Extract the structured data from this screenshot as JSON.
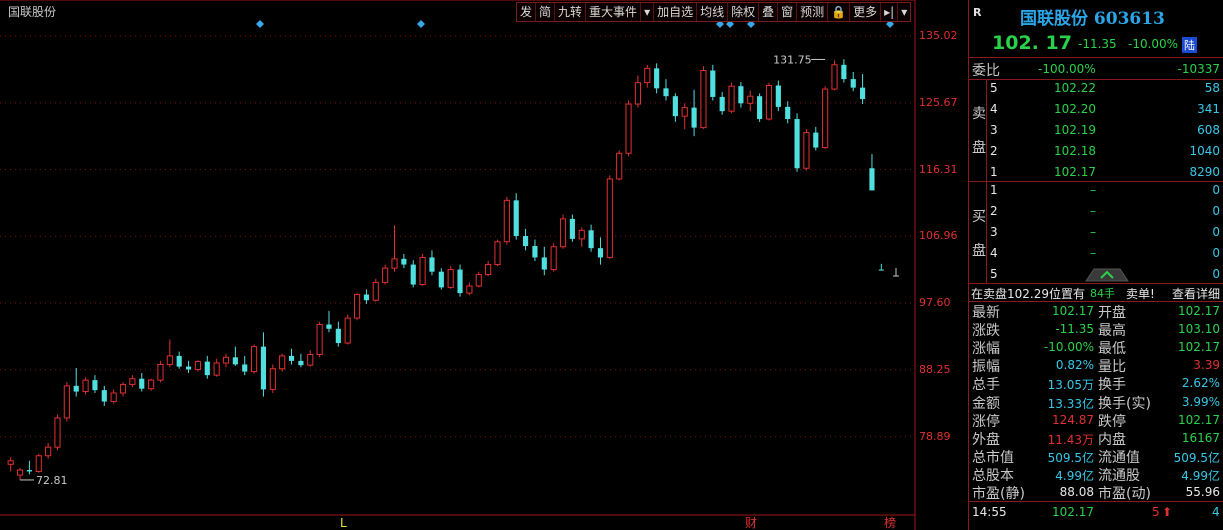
{
  "stock_label": "国联股份",
  "toolbar": [
    "发",
    "简",
    "九转",
    "重大事件",
    "▾",
    "加自选",
    "均线",
    "除权",
    "叠",
    "窗",
    "预测",
    "🔒",
    "更多",
    "▸|",
    "▾"
  ],
  "y_axis_labels": [
    "135.02",
    "125.67",
    "116.31",
    "106.96",
    "97.60",
    "88.25",
    "78.89"
  ],
  "chart_annotations": {
    "high": "131.75",
    "low": "72.81",
    "bottom_markers": [
      "L",
      "财",
      "榜"
    ]
  },
  "panel": {
    "r_logo": "R",
    "title": "国联股份 603613",
    "price": "102. 17",
    "change": "-11.35",
    "change_pct": "-10.00%",
    "limit_badge": "陆",
    "weibi_label": "委比",
    "weibi_pct": "-100.00%",
    "weibi_diff": "-10337",
    "sell_label": [
      "卖",
      "盘"
    ],
    "buy_label": [
      "买",
      "盘"
    ],
    "sell": [
      {
        "level": "5",
        "price": "102.22",
        "vol": "58"
      },
      {
        "level": "4",
        "price": "102.20",
        "vol": "341"
      },
      {
        "level": "3",
        "price": "102.19",
        "vol": "608"
      },
      {
        "level": "2",
        "price": "102.18",
        "vol": "1040"
      },
      {
        "level": "1",
        "price": "102.17",
        "vol": "8290"
      }
    ],
    "buy": [
      {
        "level": "1",
        "price": "–",
        "vol": "0"
      },
      {
        "level": "2",
        "price": "–",
        "vol": "0"
      },
      {
        "level": "3",
        "price": "–",
        "vol": "0"
      },
      {
        "level": "4",
        "price": "–",
        "vol": "0"
      },
      {
        "level": "5",
        "price": "–",
        "vol": "0"
      }
    ],
    "notice_prefix": "在卖盘102.29位置有",
    "notice_qty": "84手",
    "notice_suffix": "卖单!",
    "notice_link": "查看详细",
    "stats": [
      {
        "l1": "最新",
        "v1": "102.17",
        "c1": "g",
        "l2": "开盘",
        "v2": "102.17",
        "c2": "g"
      },
      {
        "l1": "涨跌",
        "v1": "-11.35",
        "c1": "g",
        "l2": "最高",
        "v2": "103.10",
        "c2": "g"
      },
      {
        "l1": "涨幅",
        "v1": "-10.00%",
        "c1": "g",
        "l2": "最低",
        "v2": "102.17",
        "c2": "g"
      },
      {
        "l1": "振幅",
        "v1": "0.82%",
        "c1": "c",
        "l2": "量比",
        "v2": "3.39",
        "c2": "r"
      },
      {
        "l1": "总手",
        "v1": "13.05万",
        "c1": "c",
        "l2": "换手",
        "v2": "2.62%",
        "c2": "c"
      },
      {
        "l1": "金额",
        "v1": "13.33亿",
        "c1": "c",
        "l2": "换手(实)",
        "v2": "3.99%",
        "c2": "c"
      },
      {
        "l1": "涨停",
        "v1": "124.87",
        "c1": "r",
        "l2": "跌停",
        "v2": "102.17",
        "c2": "g"
      },
      {
        "l1": "外盘",
        "v1": "11.43万",
        "c1": "r",
        "l2": "内盘",
        "v2": "16167",
        "c2": "g"
      },
      {
        "l1": "总市值",
        "v1": "509.5亿",
        "c1": "c",
        "l2": "流通值",
        "v2": "509.5亿",
        "c2": "c"
      },
      {
        "l1": "总股本",
        "v1": "4.99亿",
        "c1": "c",
        "l2": "流通股",
        "v2": "4.99亿",
        "c2": "c"
      },
      {
        "l1": "市盈(静)",
        "v1": "88.08",
        "c1": "w",
        "l2": "市盈(动)",
        "v2": "55.96",
        "c2": "w"
      }
    ],
    "tick": {
      "time": "14:55",
      "price": "102.17",
      "vol": "5",
      "n": "4"
    }
  },
  "chart_data": {
    "type": "candlestick",
    "ylim": [
      70,
      137
    ],
    "y_ticks": [
      135.02,
      125.67,
      116.31,
      106.96,
      97.6,
      88.25,
      78.89
    ],
    "high_mark": 131.75,
    "low_mark": 72.81,
    "candles": [
      [
        75.0,
        76.0,
        74.0,
        75.5
      ],
      [
        73.5,
        74.5,
        72.8,
        74.2
      ],
      [
        74.2,
        75.5,
        73.6,
        74.0
      ],
      [
        74.0,
        76.5,
        73.8,
        76.2
      ],
      [
        76.2,
        78.0,
        75.8,
        77.4
      ],
      [
        77.4,
        82.0,
        77.0,
        81.5
      ],
      [
        81.5,
        86.5,
        81.0,
        86.0
      ],
      [
        86.0,
        88.5,
        84.5,
        85.2
      ],
      [
        85.2,
        87.2,
        84.8,
        86.8
      ],
      [
        86.8,
        87.5,
        85.0,
        85.4
      ],
      [
        85.4,
        86.0,
        83.2,
        83.8
      ],
      [
        83.8,
        85.5,
        83.5,
        85.0
      ],
      [
        85.0,
        86.5,
        84.5,
        86.2
      ],
      [
        86.2,
        87.5,
        85.8,
        87.0
      ],
      [
        87.0,
        87.8,
        85.2,
        85.6
      ],
      [
        85.6,
        87.0,
        85.3,
        86.8
      ],
      [
        86.8,
        89.5,
        86.5,
        89.0
      ],
      [
        89.0,
        92.5,
        88.6,
        90.2
      ],
      [
        90.2,
        90.8,
        88.4,
        88.7
      ],
      [
        88.7,
        89.5,
        87.8,
        88.3
      ],
      [
        88.3,
        89.6,
        88.0,
        89.4
      ],
      [
        89.4,
        90.2,
        87.0,
        87.5
      ],
      [
        87.5,
        89.8,
        87.3,
        89.2
      ],
      [
        89.2,
        90.5,
        88.6,
        90.0
      ],
      [
        90.0,
        91.5,
        88.8,
        89.0
      ],
      [
        89.0,
        90.2,
        87.5,
        88.0
      ],
      [
        88.0,
        91.8,
        87.7,
        91.5
      ],
      [
        91.5,
        93.5,
        84.5,
        85.5
      ],
      [
        85.5,
        89.0,
        85.0,
        88.4
      ],
      [
        88.4,
        90.5,
        88.0,
        90.2
      ],
      [
        90.2,
        91.2,
        89.0,
        89.5
      ],
      [
        89.5,
        90.5,
        88.6,
        88.9
      ],
      [
        88.9,
        91.0,
        88.7,
        90.4
      ],
      [
        90.4,
        95.0,
        90.0,
        94.6
      ],
      [
        94.6,
        96.5,
        93.5,
        94.0
      ],
      [
        94.0,
        95.0,
        91.5,
        92.0
      ],
      [
        92.0,
        96.0,
        91.8,
        95.5
      ],
      [
        95.5,
        99.0,
        95.2,
        98.8
      ],
      [
        98.8,
        99.5,
        97.5,
        98.0
      ],
      [
        98.0,
        101.0,
        97.8,
        100.5
      ],
      [
        100.5,
        103.0,
        100.2,
        102.5
      ],
      [
        102.5,
        108.5,
        102.0,
        103.8
      ],
      [
        103.8,
        104.5,
        102.5,
        103.0
      ],
      [
        103.0,
        103.6,
        99.8,
        100.2
      ],
      [
        100.2,
        104.5,
        100.0,
        104.0
      ],
      [
        104.0,
        105.0,
        101.5,
        102.0
      ],
      [
        102.0,
        102.5,
        99.5,
        99.8
      ],
      [
        99.8,
        102.8,
        99.6,
        102.3
      ],
      [
        102.3,
        103.0,
        98.5,
        99.0
      ],
      [
        99.0,
        100.5,
        98.7,
        100.0
      ],
      [
        100.0,
        102.0,
        99.8,
        101.6
      ],
      [
        101.6,
        103.5,
        101.4,
        103.0
      ],
      [
        103.0,
        106.5,
        102.8,
        106.2
      ],
      [
        106.2,
        112.5,
        105.8,
        112.0
      ],
      [
        112.0,
        113.0,
        106.5,
        107.0
      ],
      [
        107.0,
        108.0,
        105.0,
        105.6
      ],
      [
        105.6,
        106.5,
        103.5,
        104.0
      ],
      [
        104.0,
        105.5,
        101.5,
        102.3
      ],
      [
        102.3,
        106.0,
        102.0,
        105.5
      ],
      [
        105.5,
        110.0,
        105.2,
        109.4
      ],
      [
        109.4,
        110.0,
        106.2,
        106.6
      ],
      [
        106.6,
        108.2,
        105.5,
        107.8
      ],
      [
        107.8,
        108.6,
        104.8,
        105.3
      ],
      [
        105.3,
        106.8,
        103.0,
        104.0
      ],
      [
        104.0,
        115.5,
        103.8,
        115.0
      ],
      [
        115.0,
        119.0,
        114.8,
        118.6
      ],
      [
        118.6,
        126.0,
        118.2,
        125.5
      ],
      [
        125.5,
        129.5,
        125.0,
        128.5
      ],
      [
        128.5,
        131.0,
        127.8,
        130.5
      ],
      [
        130.5,
        131.2,
        127.0,
        127.7
      ],
      [
        127.7,
        129.0,
        126.0,
        126.6
      ],
      [
        126.6,
        127.0,
        123.0,
        123.8
      ],
      [
        123.8,
        125.6,
        122.0,
        125.0
      ],
      [
        125.0,
        127.5,
        121.0,
        122.2
      ],
      [
        122.2,
        130.8,
        122.0,
        130.2
      ],
      [
        130.2,
        131.0,
        126.0,
        126.5
      ],
      [
        126.5,
        127.2,
        124.0,
        124.5
      ],
      [
        124.5,
        128.5,
        124.2,
        128.0
      ],
      [
        128.0,
        128.6,
        125.0,
        125.6
      ],
      [
        125.6,
        127.4,
        124.5,
        126.6
      ],
      [
        126.6,
        127.0,
        123.0,
        123.4
      ],
      [
        123.4,
        128.5,
        123.2,
        128.1
      ],
      [
        128.1,
        128.8,
        124.5,
        125.1
      ],
      [
        125.1,
        125.9,
        122.8,
        123.4
      ],
      [
        123.4,
        124.2,
        116.0,
        116.5
      ],
      [
        116.5,
        122.0,
        116.2,
        121.5
      ],
      [
        121.5,
        122.3,
        119.0,
        119.4
      ],
      [
        119.4,
        128.0,
        119.2,
        127.6
      ],
      [
        127.6,
        131.6,
        127.4,
        131.0
      ],
      [
        131.0,
        131.8,
        128.5,
        129.0
      ],
      [
        129.0,
        130.0,
        127.3,
        127.8
      ],
      [
        127.8,
        129.7,
        125.5,
        126.2
      ],
      [
        116.5,
        118.5,
        113.4,
        113.4
      ],
      [
        102.3,
        103.1,
        102.2,
        102.2
      ]
    ]
  }
}
